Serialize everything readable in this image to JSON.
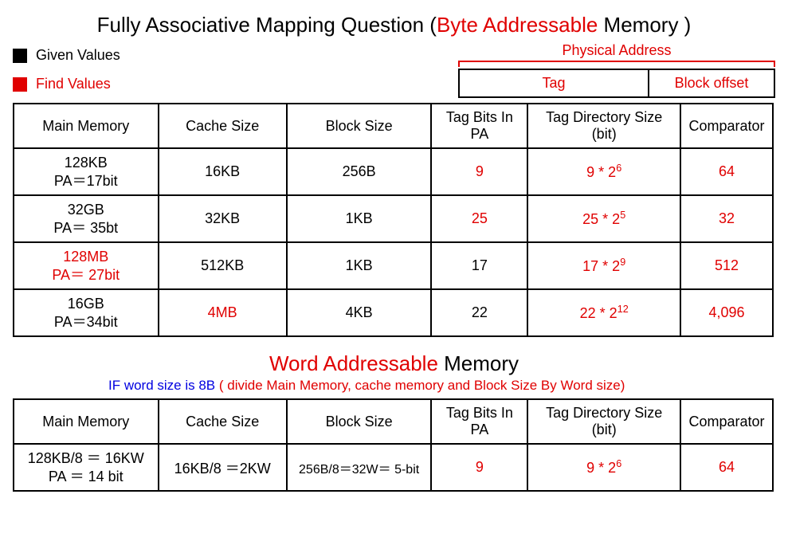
{
  "title": {
    "prefix": "Fully Associative Mapping Question (",
    "highlight": "Byte Addressable",
    "suffix": " Memory )"
  },
  "legend": {
    "given": "Given Values",
    "find": "Find Values"
  },
  "pa": {
    "label": "Physical Address",
    "tag": "Tag",
    "offset": "Block offset"
  },
  "headers": {
    "mm": "Main  Memory",
    "cs": "Cache Size",
    "bs": "Block Size",
    "tag": "Tag Bits In PA",
    "tds": "Tag Directory Size (bit)",
    "comp": "Comparator"
  },
  "rows": [
    {
      "mm_l1": "128KB",
      "mm_l2": "PA＝17bit",
      "mm_red": false,
      "cs": "16KB",
      "cs_red": false,
      "bs": "256B",
      "bs_red": false,
      "tag": "9",
      "tag_red": true,
      "tds_base": "9 * 2",
      "tds_exp": "6",
      "tds_red": true,
      "comp": "64",
      "comp_red": true
    },
    {
      "mm_l1": "32GB",
      "mm_l2": "PA＝ 35bt",
      "mm_red": false,
      "cs": "32KB",
      "cs_red": false,
      "bs": "1KB",
      "bs_red": false,
      "tag": "25",
      "tag_red": true,
      "tds_base": "25 * 2",
      "tds_exp": "5",
      "tds_red": true,
      "comp": "32",
      "comp_red": true
    },
    {
      "mm_l1": "128MB",
      "mm_l2": "PA＝ 27bit",
      "mm_red": true,
      "cs": "512KB",
      "cs_red": false,
      "bs": "1KB",
      "bs_red": false,
      "tag": "17",
      "tag_red": false,
      "tds_base": "17 * 2",
      "tds_exp": "9",
      "tds_red": true,
      "comp": "512",
      "comp_red": true
    },
    {
      "mm_l1": "16GB",
      "mm_l2": "PA＝34bit",
      "mm_red": false,
      "cs": "4MB",
      "cs_red": true,
      "bs": "4KB",
      "bs_red": false,
      "tag": "22",
      "tag_red": false,
      "tds_base": "22 * 2",
      "tds_exp": "12",
      "tds_red": true,
      "comp": "4,096",
      "comp_red": true
    }
  ],
  "section2": {
    "title_red": "Word Addressable",
    "title_black": " Memory",
    "if_prefix": "IF word size is 8B",
    "if_suffix": " ( divide Main Memory, cache memory and Block Size By Word size)"
  },
  "rows2": [
    {
      "mm_l1": "128KB/8 ＝ 16KW",
      "mm_l2": "PA ＝ 14 bit",
      "cs": "16KB/8 ＝2KW",
      "bs": "256B/8＝32W＝ 5-bit",
      "tag": "9",
      "tds_base": "9 * 2",
      "tds_exp": "6",
      "comp": "64"
    }
  ]
}
